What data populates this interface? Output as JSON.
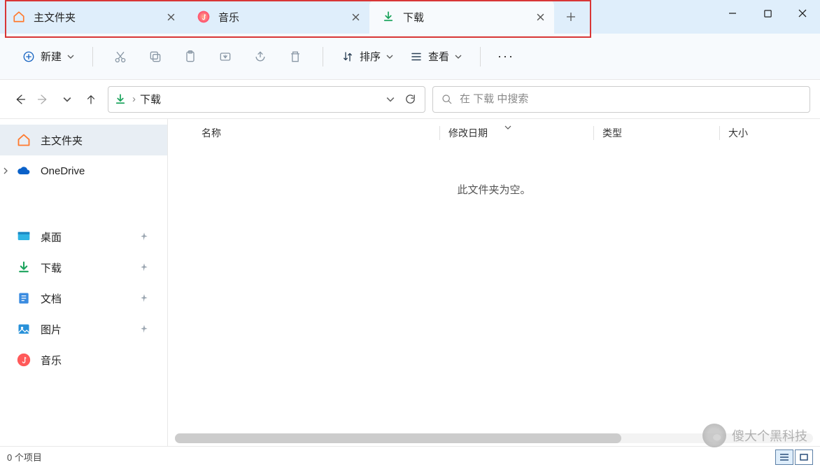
{
  "tabs": [
    {
      "label": "主文件夹",
      "icon": "home"
    },
    {
      "label": "音乐",
      "icon": "music"
    },
    {
      "label": "下载",
      "icon": "download",
      "active": true
    }
  ],
  "toolbar": {
    "new_label": "新建",
    "sort_label": "排序",
    "view_label": "查看"
  },
  "address": {
    "current": "下载",
    "separator": "›"
  },
  "search": {
    "placeholder": "在 下载 中搜索"
  },
  "sidebar": {
    "items": [
      {
        "label": "主文件夹",
        "icon": "home",
        "active": true
      },
      {
        "label": "OneDrive",
        "icon": "onedrive",
        "expandable": true
      }
    ],
    "quick": [
      {
        "label": "桌面",
        "icon": "desktop",
        "pinned": true
      },
      {
        "label": "下载",
        "icon": "download",
        "pinned": true
      },
      {
        "label": "文档",
        "icon": "documents",
        "pinned": true
      },
      {
        "label": "图片",
        "icon": "pictures",
        "pinned": true
      },
      {
        "label": "音乐",
        "icon": "music",
        "pinned": false
      }
    ]
  },
  "columns": {
    "name": "名称",
    "date": "修改日期",
    "type": "类型",
    "size": "大小"
  },
  "empty_message": "此文件夹为空。",
  "status": {
    "count_label": "0 个项目"
  },
  "watermark": {
    "text": "傻大个黑科技"
  }
}
